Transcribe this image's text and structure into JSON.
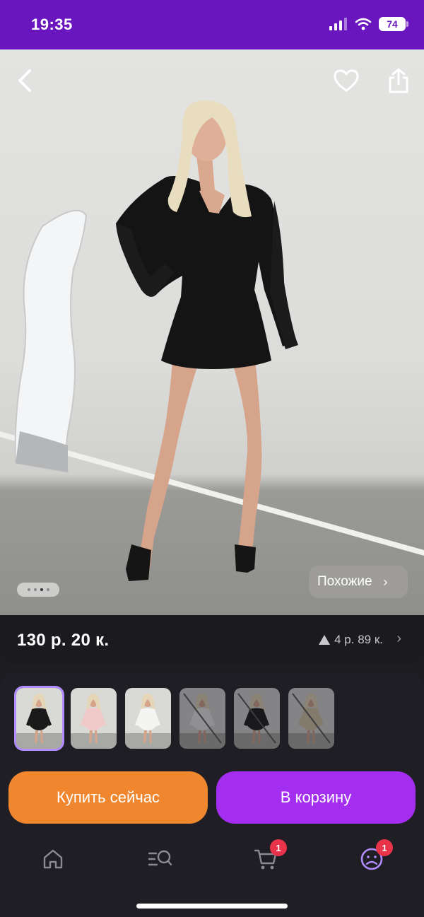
{
  "status_bar": {
    "time": "19:35",
    "battery": "74"
  },
  "product": {
    "price": "130 р. 20 к.",
    "price_change": "4 р. 89 к.",
    "similar_label": "Похожие"
  },
  "gallery": {
    "dots_count": 4,
    "active_dot": 2
  },
  "variants": [
    {
      "name": "black",
      "selected": true,
      "available": true,
      "color": "#1a1a1a"
    },
    {
      "name": "pink",
      "selected": false,
      "available": true,
      "color": "#f1c9c8"
    },
    {
      "name": "white",
      "selected": false,
      "available": true,
      "color": "#f4f4f2"
    },
    {
      "name": "white-unavailable",
      "selected": false,
      "available": false,
      "color": "#eeeeec"
    },
    {
      "name": "black-unavailable",
      "selected": false,
      "available": false,
      "color": "#151515"
    },
    {
      "name": "beige-unavailable",
      "selected": false,
      "available": false,
      "color": "#d8c6a8"
    }
  ],
  "actions": {
    "buy_now": "Купить сейчас",
    "add_to_cart": "В корзину"
  },
  "tabbar": {
    "cart_badge": "1",
    "profile_badge": "1"
  },
  "colors": {
    "accent": "#6a16bf",
    "buy": "#f0862e",
    "cart": "#a32ef0",
    "badge": "#e8334a",
    "selected_outline": "#b18cff"
  }
}
